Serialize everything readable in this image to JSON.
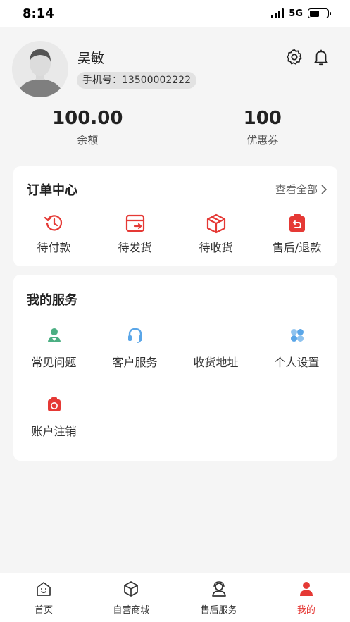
{
  "status_bar": {
    "time": "8:14",
    "network": "5G"
  },
  "profile": {
    "name": "吴敏",
    "phone_label": "手机号：",
    "phone": "13500002222"
  },
  "stats": [
    {
      "value": "100.00",
      "label": "余额"
    },
    {
      "value": "100",
      "label": "优惠券"
    }
  ],
  "orders": {
    "title": "订单中心",
    "view_all": "查看全部",
    "items": [
      {
        "label": "待付款",
        "icon": "pending-payment-icon"
      },
      {
        "label": "待发货",
        "icon": "pending-shipment-icon"
      },
      {
        "label": "待收货",
        "icon": "pending-receipt-icon"
      },
      {
        "label": "售后/退款",
        "icon": "refund-icon"
      }
    ]
  },
  "services": {
    "title": "我的服务",
    "items": [
      {
        "label": "常见问题",
        "icon": "faq-icon"
      },
      {
        "label": "客户服务",
        "icon": "headset-icon"
      },
      {
        "label": "收货地址",
        "icon": ""
      },
      {
        "label": "个人设置",
        "icon": "settings-grid-icon"
      },
      {
        "label": "账户注销",
        "icon": "account-cancel-icon"
      }
    ]
  },
  "tabbar": [
    {
      "label": "首页",
      "icon": "home-icon"
    },
    {
      "label": "自营商城",
      "icon": "box-icon"
    },
    {
      "label": "售后服务",
      "icon": "support-agent-icon"
    },
    {
      "label": "我的",
      "icon": "user-icon",
      "active": true
    }
  ],
  "colors": {
    "accent": "#e53935",
    "background": "#f5f5f5",
    "card": "#ffffff",
    "green": "#4caf83",
    "blue": "#5aa6e8"
  }
}
